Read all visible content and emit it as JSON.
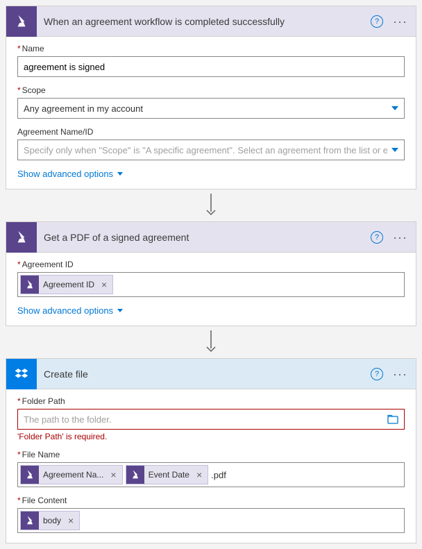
{
  "steps": [
    {
      "title": "When an agreement workflow is completed successfully",
      "fields": {
        "name_label": "Name",
        "name_value": "agreement is signed",
        "scope_label": "Scope",
        "scope_value": "Any agreement in my account",
        "agid_label": "Agreement Name/ID",
        "agid_placeholder": "Specify only when \"Scope\" is \"A specific agreement\". Select an agreement from the list or enter th"
      },
      "show_adv": "Show advanced options"
    },
    {
      "title": "Get a PDF of a signed agreement",
      "fields": {
        "agid_label": "Agreement ID",
        "token_label": "Agreement ID"
      },
      "show_adv": "Show advanced options"
    },
    {
      "title": "Create file",
      "fields": {
        "folder_label": "Folder Path",
        "folder_placeholder": "The path to the folder.",
        "folder_error": "'Folder Path' is required.",
        "filename_label": "File Name",
        "filename_token1": "Agreement Na...",
        "filename_token2": "Event Date",
        "filename_ext": ".pdf",
        "content_label": "File Content",
        "content_token": "body"
      }
    }
  ]
}
